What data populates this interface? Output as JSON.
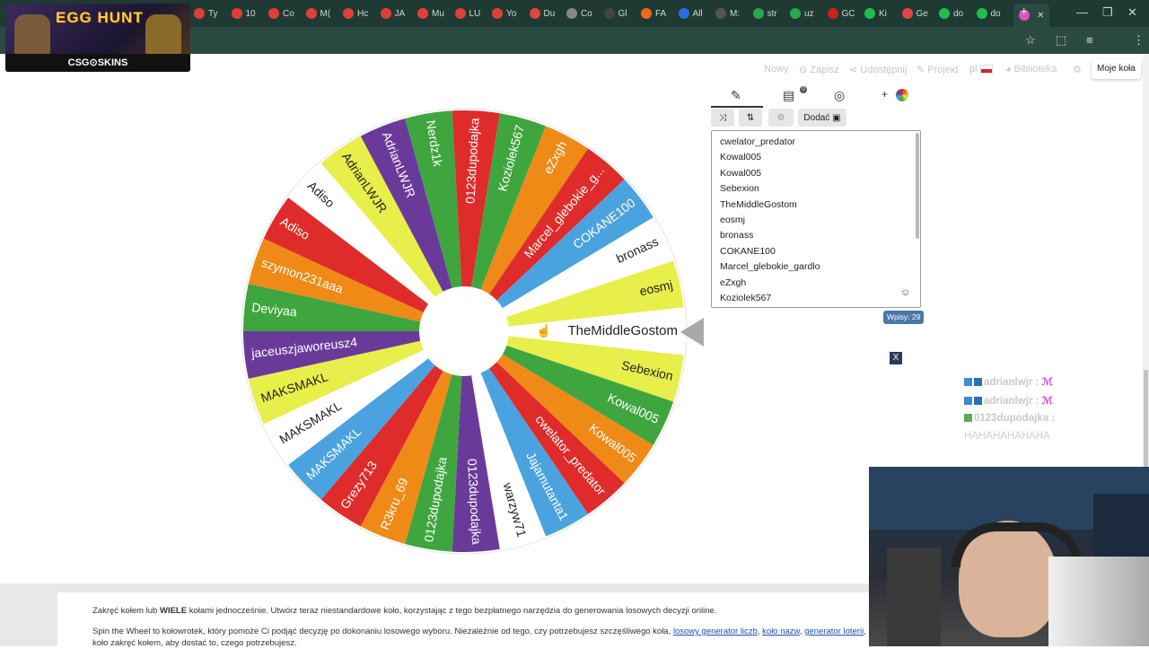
{
  "browser": {
    "tabs": [
      {
        "label": "Ty",
        "color": "#e03d3d"
      },
      {
        "label": "10",
        "color": "#e03d3d"
      },
      {
        "label": "Co",
        "color": "#e03d3d"
      },
      {
        "label": "M(",
        "color": "#e03d3d"
      },
      {
        "label": "Hc",
        "color": "#e03d3d"
      },
      {
        "label": "JA",
        "color": "#e03d3d"
      },
      {
        "label": "Mu",
        "color": "#e03d3d"
      },
      {
        "label": "LU",
        "color": "#e03d3d"
      },
      {
        "label": "Yo",
        "color": "#e03d3d"
      },
      {
        "label": "Du",
        "color": "#e04545"
      },
      {
        "label": "Co",
        "color": "#888888"
      },
      {
        "label": "Gl",
        "color": "#444444"
      },
      {
        "label": "FA",
        "color": "#f06a1a"
      },
      {
        "label": "All",
        "color": "#2d6be0"
      },
      {
        "label": "M:",
        "color": "#555555"
      },
      {
        "label": "str",
        "color": "#2aa84a"
      },
      {
        "label": "uz",
        "color": "#2aa84a"
      },
      {
        "label": "GC",
        "color": "#d02020"
      },
      {
        "label": "Ki",
        "color": "#1fbe50"
      },
      {
        "label": "Ge",
        "color": "#e04545"
      },
      {
        "label": "do",
        "color": "#1fbe50"
      },
      {
        "label": "do",
        "color": "#1fbe50"
      },
      {
        "label": "",
        "color": "#e84cc0"
      }
    ],
    "new_tab": "+",
    "active_close": "✕"
  },
  "overlay": {
    "title": "EGG HUNT",
    "subtitle": "CSG⊙SKINS"
  },
  "site_nav": {
    "nowy": "Nowy",
    "zapisz": "Zapisz",
    "udostepnij": "Udostępnij",
    "projekt": "Projekt",
    "lang": "pl",
    "biblioteka": "Biblioteka",
    "moje_kola": "Moje koła"
  },
  "wheel": {
    "segments": [
      {
        "label": "TheMiddleGostom",
        "color": "#ffffff"
      },
      {
        "label": "Sebexion",
        "color": "#e8ee4a"
      },
      {
        "label": "Kowal005",
        "color": "#3fa63f"
      },
      {
        "label": "Kowal005",
        "color": "#ef8a17"
      },
      {
        "label": "cwelator_predator",
        "color": "#e02b2b"
      },
      {
        "label": "Jajamutanta1",
        "color": "#4aa3df"
      },
      {
        "label": "warzyw71",
        "color": "#ffffff"
      },
      {
        "label": "0123dupodajka",
        "color": "#6a3a9a"
      },
      {
        "label": "0123dupodajka",
        "color": "#3fa63f"
      },
      {
        "label": "R3kru_69",
        "color": "#ef8a17"
      },
      {
        "label": "Grezy713",
        "color": "#e02b2b"
      },
      {
        "label": "MAKSMAKL",
        "color": "#4aa3df"
      },
      {
        "label": "MAKSMAKL",
        "color": "#ffffff"
      },
      {
        "label": "MAKSMAKL",
        "color": "#e8ee4a"
      },
      {
        "label": "jaceuszjaworeusz4",
        "color": "#6a3a9a"
      },
      {
        "label": "Deviyaa",
        "color": "#3fa63f"
      },
      {
        "label": "szymon231aaa",
        "color": "#ef8a17"
      },
      {
        "label": "Adiso",
        "color": "#e02b2b"
      },
      {
        "label": "Adiso",
        "color": "#ffffff"
      },
      {
        "label": "AdrianLWJR",
        "color": "#e8ee4a"
      },
      {
        "label": "AdrianLWJR",
        "color": "#6a3a9a"
      },
      {
        "label": "Nerdz1k",
        "color": "#3fa63f"
      },
      {
        "label": "0123dupodajka",
        "color": "#e02b2b"
      },
      {
        "label": "Koziolek567",
        "color": "#3fa63f"
      },
      {
        "label": "eZxgh",
        "color": "#ef8a17"
      },
      {
        "label": "Marcel_glebokie_g...",
        "color": "#e02b2b"
      },
      {
        "label": "COKANE100",
        "color": "#4aa3df"
      },
      {
        "label": "bronass",
        "color": "#ffffff"
      },
      {
        "label": "eosmj",
        "color": "#e8ee4a"
      }
    ]
  },
  "editor": {
    "add_label": "Dodać",
    "entries": [
      "cwelator_predator",
      "Kowal005",
      "Kowal005",
      "Sebexion",
      "TheMiddleGostom",
      "eosmj",
      "bronass",
      "COKANE100",
      "Marcel_glebokie_gardlo",
      "eZxgh",
      "Koziolek567"
    ],
    "count_label": "Wpisy: 29",
    "close": "X"
  },
  "chat": {
    "line1_user": "adrianlwjr :",
    "line2_user": "adrianlwjr :",
    "line3_user": "0123dupodajka :",
    "line3_msg": "HAHAHAHAHAHA"
  },
  "bottom": {
    "line1_a": "Zakręć kołem lub ",
    "line1_b": "WIELE",
    "line1_c": " kołami jednocześnie. Utwórz teraz niestandardowe koło, korzystając z tego bezpłatnego narzędzia do generowania losowych decyzji online.",
    "line2_a": "Spin the Wheel to kołowrotek, który pomoże Ci podjąć decyzję po dokonaniu losowego wyboru. Niezależnie od tego, czy potrzebujesz szczęśliwego koła, ",
    "link1": "losowy generator liczb",
    "link2": "koło nazw",
    "link3": "generator loterii",
    "line2_b": ", koło zakręć kołem, aby dostać to, czego potrzebujesz."
  }
}
